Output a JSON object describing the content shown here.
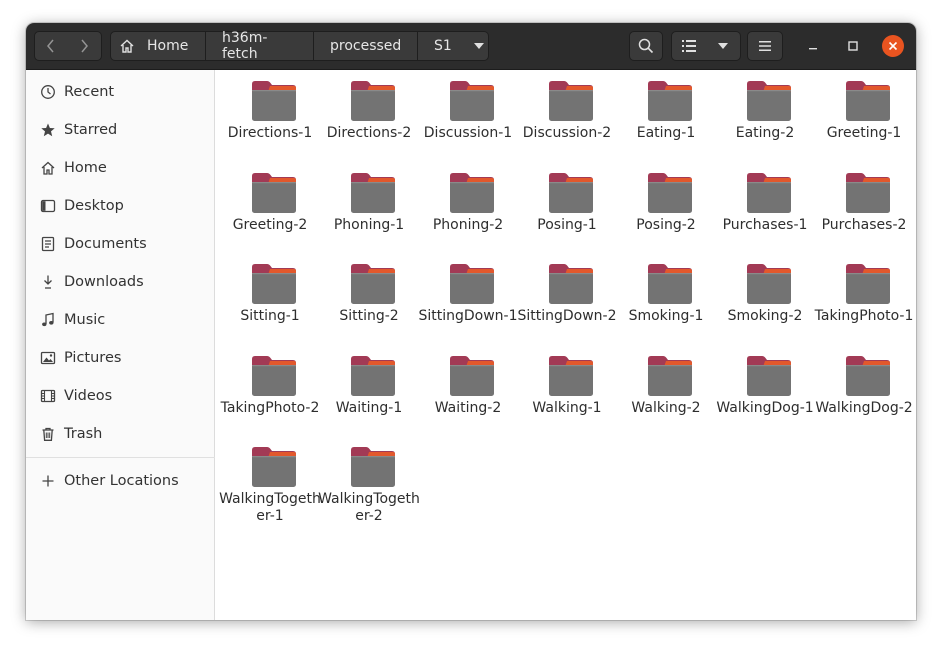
{
  "window": {
    "breadcrumbs": [
      "Home",
      "h36m-fetch",
      "processed",
      "S1"
    ],
    "accent": "#e95420"
  },
  "headerbar": {
    "back_icon": "chevron-left-icon",
    "forward_icon": "chevron-right-icon",
    "search_icon": "search-icon",
    "view_icon": "list-view-icon",
    "menu_icon": "hamburger-icon"
  },
  "sidebar": {
    "items": [
      {
        "label": "Recent",
        "icon": "clock-icon"
      },
      {
        "label": "Starred",
        "icon": "star-icon"
      },
      {
        "label": "Home",
        "icon": "home-icon"
      },
      {
        "label": "Desktop",
        "icon": "desktop-icon"
      },
      {
        "label": "Documents",
        "icon": "document-icon"
      },
      {
        "label": "Downloads",
        "icon": "download-icon"
      },
      {
        "label": "Music",
        "icon": "music-icon"
      },
      {
        "label": "Pictures",
        "icon": "picture-icon"
      },
      {
        "label": "Videos",
        "icon": "video-icon"
      },
      {
        "label": "Trash",
        "icon": "trash-icon"
      }
    ],
    "other_locations": "Other Locations"
  },
  "folders": [
    "Directions-1",
    "Directions-2",
    "Discussion-1",
    "Discussion-2",
    "Eating-1",
    "Eating-2",
    "Greeting-1",
    "Greeting-2",
    "Phoning-1",
    "Phoning-2",
    "Posing-1",
    "Posing-2",
    "Purchases-1",
    "Purchases-2",
    "Sitting-1",
    "Sitting-2",
    "SittingDown-1",
    "SittingDown-2",
    "Smoking-1",
    "Smoking-2",
    "TakingPhoto-1",
    "TakingPhoto-2",
    "Waiting-1",
    "Waiting-2",
    "Walking-1",
    "Walking-2",
    "WalkingDog-1",
    "WalkingDog-2",
    "WalkingTogether-1",
    "WalkingTogether-2"
  ]
}
